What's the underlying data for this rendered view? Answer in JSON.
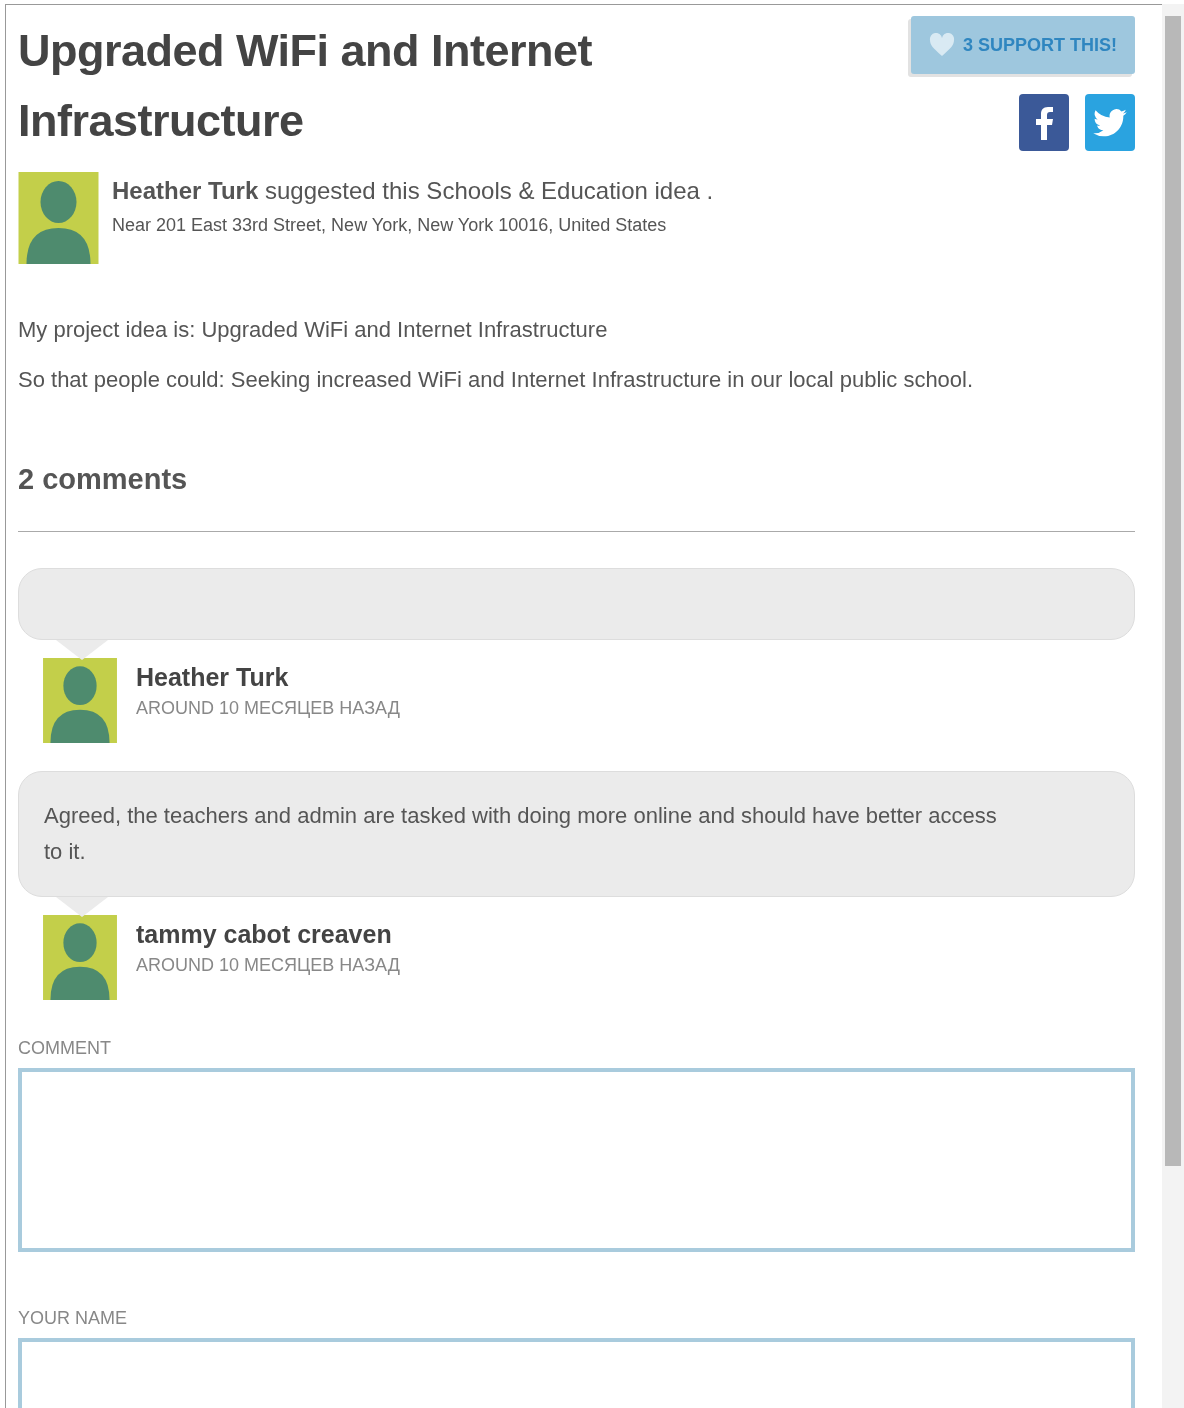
{
  "title": "Upgraded WiFi and Internet Infrastructure",
  "support_button": {
    "label": "3 SUPPORT THIS!"
  },
  "share": [
    {
      "kind": "facebook"
    },
    {
      "kind": "twitter"
    }
  ],
  "author_line": "**Heather Turk** suggested this Schools & Education idea .",
  "location": "Near 201 East 33rd Street, New York, New York 10016, United States",
  "description": [
    "My project idea is: Upgraded WiFi and Internet Infrastructure",
    "So that people could: Seeking increased WiFi and Internet Infrastructure in our local public school."
  ],
  "comments_heading": "2 comments",
  "comments": [
    {
      "author": "Heather Turk",
      "time": "AROUND 10 МЕСЯЦЕВ НАЗАД"
    },
    {
      "text": "Agreed, the teachers and admin are tasked with doing more online and should have better access to it.",
      "author": "tammy cabot creaven",
      "time": "AROUND 10 МЕСЯЦЕВ НАЗАД"
    }
  ],
  "form": [
    {
      "kind": "textarea",
      "label": "COMMENT"
    },
    {
      "kind": "input",
      "label": "YOUR NAME"
    }
  ]
}
